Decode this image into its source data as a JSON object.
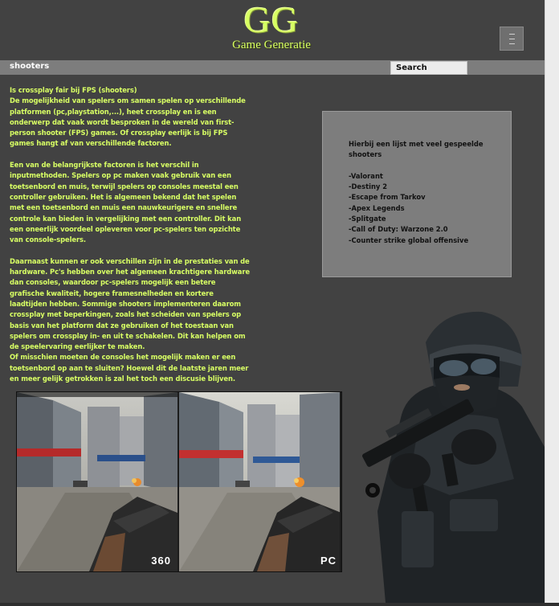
{
  "header": {
    "logo_mark": "GG",
    "logo_text": "Game Generatie",
    "menu_icon": "hamburger-icon"
  },
  "nav": {
    "label": "shooters",
    "search_label": "Search"
  },
  "article": {
    "title": "Is crossplay fair bij FPS (shooters)",
    "paragraphs": [
      "De mogelijkheid van spelers om samen spelen op verschillende platformen (pc,playstation,...), heet crossplay en is een onderwerp dat vaak wordt besproken in de wereld van first-person shooter (FPS) games. Of crossplay eerlijk is bij FPS games hangt af van verschillende factoren.",
      "Een van de belangrijkste factoren is het verschil in inputmethoden. Spelers op pc maken vaak gebruik van een toetsenbord en muis, terwijl spelers op consoles meestal een controller gebruiken. Het is algemeen bekend dat het spelen met een toetsenbord en muis een nauwkeurigere en snellere controle kan bieden in vergelijking met een controller. Dit kan een oneerlijk voordeel opleveren voor pc-spelers ten opzichte van console-spelers.",
      "Daarnaast kunnen er ook verschillen zijn in de prestaties van de hardware. Pc's hebben over het algemeen krachtigere hardware dan consoles, waardoor pc-spelers mogelijk een betere grafische kwaliteit, hogere framesnelheden en kortere laadtijden hebben. Sommige shooters implementeren daarom crossplay met beperkingen, zoals het scheiden van spelers op basis van het platform dat ze gebruiken of het toestaan van spelers om crossplay in- en uit te schakelen. Dit kan helpen om de speelervaring eerlijker te maken.",
      "Of misschien moeten de consoles het mogelijk maken er een toetsenbord op aan te sluiten? Hoewel dit de laatste jaren meer en meer gelijk getrokken is zal het toch een discusie blijven."
    ]
  },
  "games_box": {
    "intro": "Hierbij een lijst met veel gespeelde shooters",
    "items": [
      "-Valorant",
      "-Destiny 2",
      "-Escape from Tarkov",
      "-Apex Legends",
      "-Splitgate",
      "-Call of Duty: Warzone 2.0",
      "-Counter strike global offensive"
    ]
  },
  "comparison": {
    "left_label": "360",
    "right_label": "PC"
  },
  "colors": {
    "accent": "#d7ff62",
    "background": "#424242",
    "navbar": "#7d7d7d"
  }
}
